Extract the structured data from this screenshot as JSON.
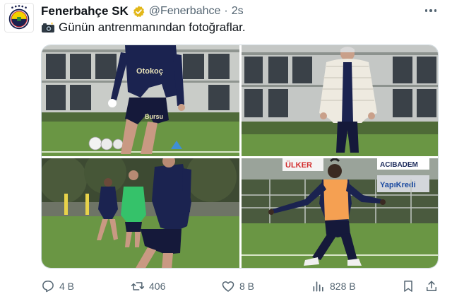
{
  "tweet": {
    "display_name": "Fenerbahçe SK",
    "handle": "@Fenerbahce",
    "separator": "·",
    "time": "2s",
    "text": "Günün antrenmanından fotoğraflar.",
    "text_emoji": "camera-with-flash-icon"
  },
  "photos": [
    {
      "name": "photo-player-ball",
      "shirt_sponsor": "Otokoç",
      "shorts_text": "Bursu"
    },
    {
      "name": "photo-coach-white-jacket"
    },
    {
      "name": "photo-players-running"
    },
    {
      "name": "photo-player-orange-bib",
      "banner_left": "ÜLKER",
      "banner_right_top": "ACIBADEM",
      "banner_right_bottom": "YapıKredi"
    }
  ],
  "actions": {
    "replies": "4 B",
    "retweets": "406",
    "likes": "8 B",
    "views": "828 B"
  },
  "colors": {
    "text": "#0f1419",
    "secondary": "#536471",
    "verified_badge": "#e2b719",
    "border": "#cfd9de",
    "navy_kit": "#1b2350",
    "orange_bib": "#f5a052",
    "pitch_green": "#5f8a3e"
  }
}
